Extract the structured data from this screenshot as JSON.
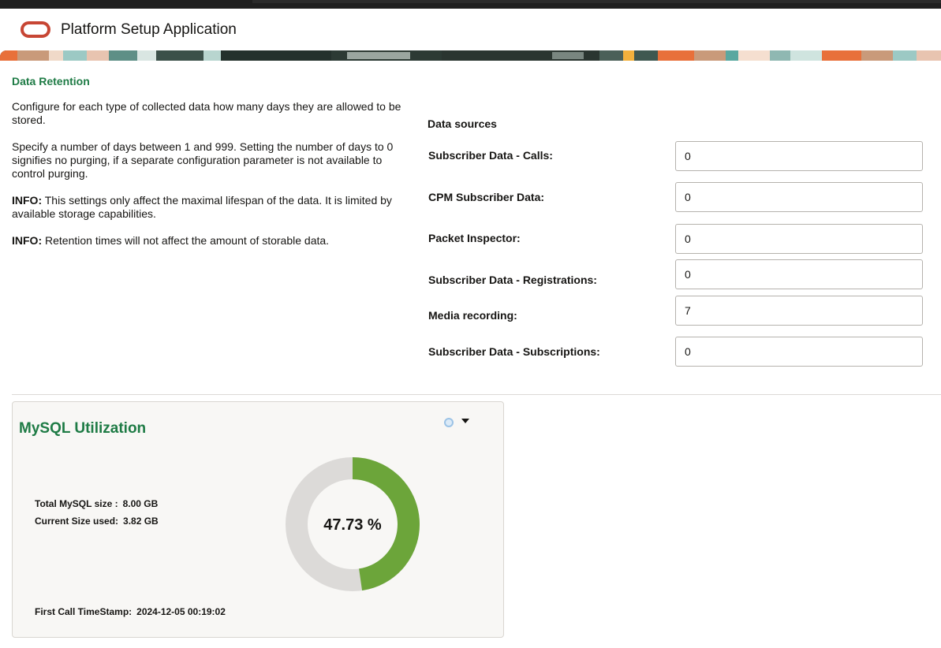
{
  "header": {
    "app_title": "Platform Setup Application"
  },
  "section": {
    "title": "Data Retention",
    "paragraphs": {
      "p1": "Configure for each type of collected data how many days they are allowed to be stored.",
      "p2": "Specify a number of days between 1 and 999. Setting the number of days to 0 signifies no purging, if a separate configuration parameter is not available to control purging.",
      "p3_prefix": "INFO:",
      "p3": " This settings only affect the maximal lifespan of the data. It is limited by available storage capabilities.",
      "p4_prefix": "INFO:",
      "p4": " Retention times will not affect the amount of storable data."
    }
  },
  "data_sources": {
    "heading": "Data sources",
    "items": [
      {
        "label": "Subscriber Data - Calls:",
        "value": "0"
      },
      {
        "label": "CPM Subscriber Data:",
        "value": "0"
      },
      {
        "label": "Packet Inspector:",
        "value": "0"
      },
      {
        "label": "Subscriber Data - Registrations:",
        "value": "0"
      },
      {
        "label": "Media recording:",
        "value": "7"
      },
      {
        "label": "Subscriber Data - Subscriptions:",
        "value": "0"
      }
    ]
  },
  "mysql_card": {
    "title": "MySQL Utilization",
    "total_label": "Total MySQL size :",
    "total_value": "8.00 GB",
    "used_label": "Current Size used:",
    "used_value": "3.82 GB",
    "timestamp_label": "First Call TimeStamp:",
    "timestamp_value": "2024-12-05 00:19:02",
    "percent_label": "47.73 %",
    "percent": 47.73,
    "colors": {
      "used": "#6ca53a",
      "free": "#dcdad8"
    }
  },
  "colors": {
    "accent_green": "#1e7b45",
    "oracle_red": "#c74634"
  }
}
